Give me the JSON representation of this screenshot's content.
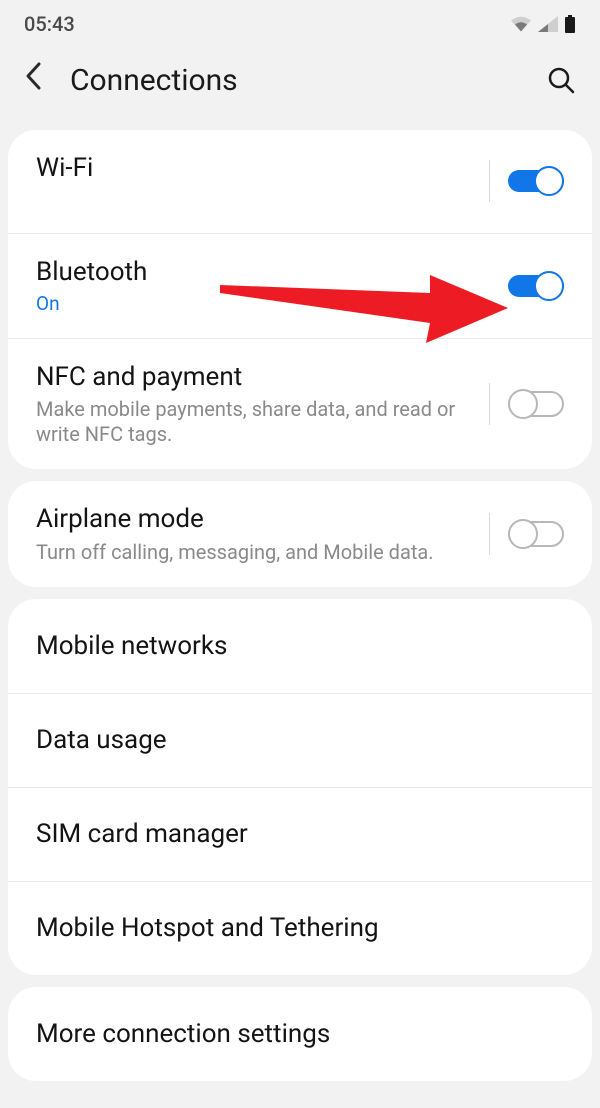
{
  "status": {
    "time": "05:43"
  },
  "header": {
    "title": "Connections"
  },
  "wifi": {
    "title": "Wi-Fi",
    "sub": " ",
    "on": true
  },
  "bluetooth": {
    "title": "Bluetooth",
    "sub": "On",
    "on": true
  },
  "nfc": {
    "title": "NFC and payment",
    "sub": "Make mobile payments, share data, and read or write NFC tags.",
    "on": false
  },
  "airplane": {
    "title": "Airplane mode",
    "sub": "Turn off calling, messaging, and Mobile data.",
    "on": false
  },
  "links": {
    "mobile_networks": "Mobile networks",
    "data_usage": "Data usage",
    "sim_manager": "SIM card manager",
    "hotspot": "Mobile Hotspot and Tethering",
    "more": "More connection settings"
  },
  "colors": {
    "accent": "#1176e8",
    "annotate": "#ed1c24"
  }
}
